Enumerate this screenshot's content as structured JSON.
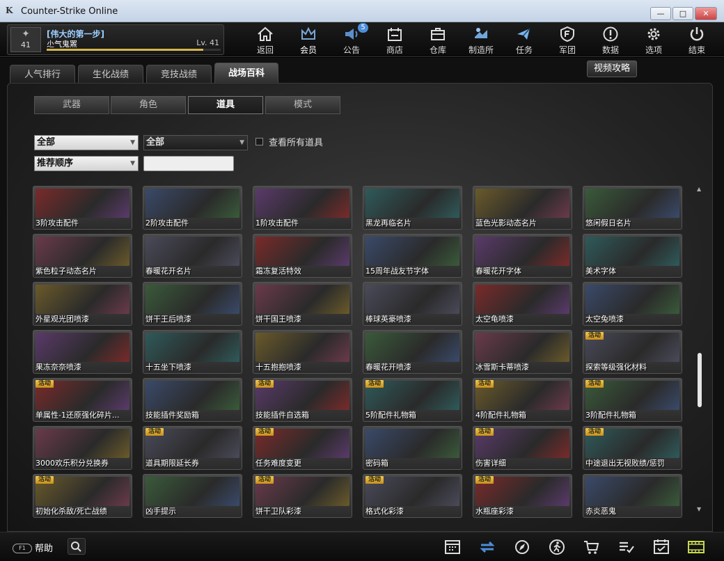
{
  "window": {
    "title": "Counter-Strike Online",
    "logo": "K"
  },
  "profile": {
    "clan": "[伟大的第一步]",
    "nickname": "尐气鬼罴",
    "level": "Lv. 41",
    "rank_number": "41",
    "exp_fraction": 0.9
  },
  "nav": [
    {
      "label": "返回",
      "icon": "home-icon"
    },
    {
      "label": "会员",
      "icon": "crown-icon"
    },
    {
      "label": "公告",
      "icon": "megaphone-icon",
      "badge": "5"
    },
    {
      "label": "商店",
      "icon": "shop-icon"
    },
    {
      "label": "仓库",
      "icon": "briefcase-icon"
    },
    {
      "label": "制造所",
      "icon": "crafting-icon"
    },
    {
      "label": "任务",
      "icon": "mission-icon"
    },
    {
      "label": "军团",
      "icon": "clan-shield-icon"
    },
    {
      "label": "数据",
      "icon": "info-icon"
    },
    {
      "label": "选项",
      "icon": "gear-icon"
    },
    {
      "label": "结束",
      "icon": "power-icon"
    }
  ],
  "main_tabs": [
    "人气排行",
    "生化战绩",
    "竞技战绩",
    "战场百科"
  ],
  "video_button": "视频攻略",
  "sub_tabs": [
    "武器",
    "角色",
    "道具",
    "模式"
  ],
  "filters": {
    "category": "全部",
    "subcategory": "全部",
    "sort": "推荐顺序",
    "show_all_label": "查看所有道具",
    "search_value": ""
  },
  "items": [
    {
      "name": "3阶攻击配件",
      "event": ""
    },
    {
      "name": "2阶攻击配件",
      "event": ""
    },
    {
      "name": "1阶攻击配件",
      "event": ""
    },
    {
      "name": "黑龙再临名片",
      "event": ""
    },
    {
      "name": "蓝色光影动态名片",
      "event": ""
    },
    {
      "name": "悠闲假日名片",
      "event": ""
    },
    {
      "name": "紫色粒子动态名片",
      "event": ""
    },
    {
      "name": "春暖花开名片",
      "event": ""
    },
    {
      "name": "霜冻复活特效",
      "event": ""
    },
    {
      "name": "15周年战友节字体",
      "event": ""
    },
    {
      "name": "春暖花开字体",
      "event": ""
    },
    {
      "name": "美术字体",
      "event": ""
    },
    {
      "name": "外星观光团喷漆",
      "event": ""
    },
    {
      "name": "饼干王后喷漆",
      "event": ""
    },
    {
      "name": "饼干国王喷漆",
      "event": ""
    },
    {
      "name": "棒球英豪喷漆",
      "event": ""
    },
    {
      "name": "太空龟喷漆",
      "event": ""
    },
    {
      "name": "太空兔喷漆",
      "event": ""
    },
    {
      "name": "果冻奈奈喷漆",
      "event": ""
    },
    {
      "name": "十五坐下喷漆",
      "event": ""
    },
    {
      "name": "十五抱抱喷漆",
      "event": ""
    },
    {
      "name": "春暖花开喷漆",
      "event": ""
    },
    {
      "name": "冰雪斯卡蒂喷漆",
      "event": ""
    },
    {
      "name": "探索等级强化材料",
      "event": "活动"
    },
    {
      "name": "单属性-1还原强化碎片...",
      "event": "活动"
    },
    {
      "name": "技能插件奖励箱",
      "event": ""
    },
    {
      "name": "技能插件自选箱",
      "event": "活动"
    },
    {
      "name": "5阶配件礼物箱",
      "event": "活动"
    },
    {
      "name": "4阶配件礼物箱",
      "event": "活动"
    },
    {
      "name": "3阶配件礼物箱",
      "event": "活动"
    },
    {
      "name": "3000欢乐积分兑换券",
      "event": ""
    },
    {
      "name": "道具期限延长券",
      "event": "活动"
    },
    {
      "name": "任务难度变更",
      "event": "活动"
    },
    {
      "name": "密码箱",
      "event": ""
    },
    {
      "name": "伤害详细",
      "event": "活动"
    },
    {
      "name": "中途退出无视败绩/惩罚",
      "event": "活动"
    },
    {
      "name": "初始化杀敌/死亡战绩",
      "event": "活动"
    },
    {
      "name": "凶手提示",
      "event": ""
    },
    {
      "name": "饼干卫队彩漆",
      "event": "活动"
    },
    {
      "name": "格式化彩漆",
      "event": "活动"
    },
    {
      "name": "水瓶座彩漆",
      "event": "活动"
    },
    {
      "name": "赤炎恶鬼",
      "event": ""
    }
  ],
  "footer": {
    "help_label": "帮助",
    "help_pill": "F1",
    "icons": [
      "calendar-icon",
      "refresh-icon",
      "compass-icon",
      "runner-icon",
      "cart-icon",
      "checklist-icon",
      "task-calendar-icon",
      "film-icon"
    ]
  },
  "colors": {
    "accent_gold": "#d6b64c",
    "clan_blue": "#9ccfff",
    "badge_blue": "#4c8edb",
    "event_badge": "#e8b43a"
  }
}
